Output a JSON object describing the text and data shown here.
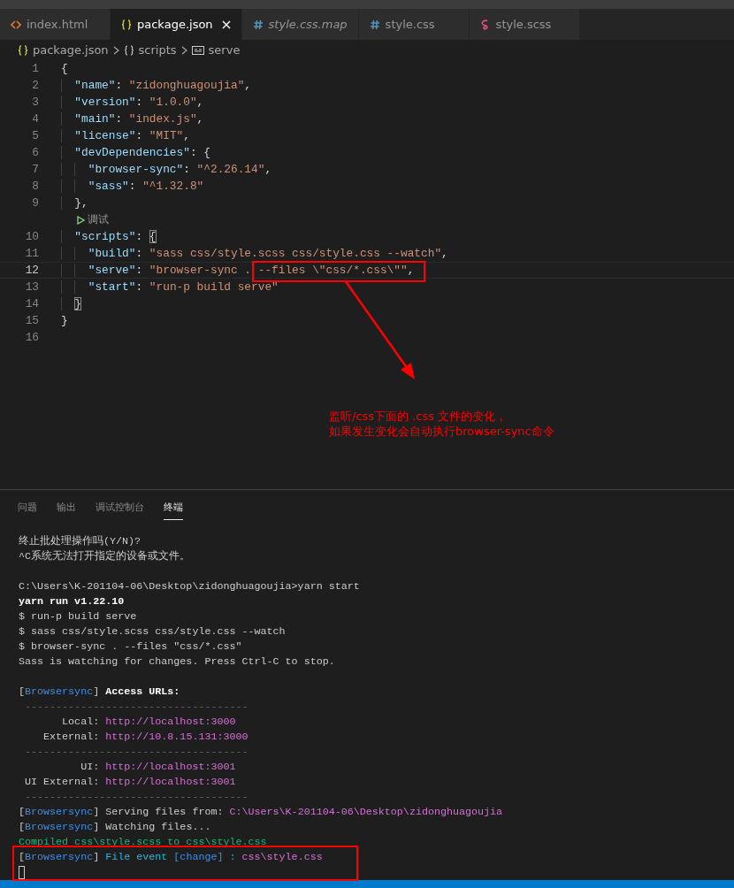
{
  "tabs": [
    {
      "label": "index.html",
      "kind": "html",
      "selected": false,
      "preview": false
    },
    {
      "label": "package.json",
      "kind": "json",
      "selected": true,
      "preview": false
    },
    {
      "label": "style.css.map",
      "kind": "css",
      "selected": false,
      "preview": true
    },
    {
      "label": "style.css",
      "kind": "css",
      "selected": false,
      "preview": false
    },
    {
      "label": "style.scss",
      "kind": "sass",
      "selected": false,
      "preview": false
    }
  ],
  "breadcrumb": [
    {
      "label": "package.json",
      "kind": "json"
    },
    {
      "label": "scripts",
      "kind": "object"
    },
    {
      "label": "serve",
      "kind": "string"
    }
  ],
  "editor": {
    "lines": [
      {
        "kind": "code",
        "number": "1",
        "current": false,
        "segments": [
          {
            "kind": "punct",
            "text": "{"
          }
        ]
      },
      {
        "kind": "code",
        "number": "2",
        "current": false,
        "segments": [
          {
            "kind": "key",
            "text": "  \"name\""
          },
          {
            "kind": "punct",
            "text": ": "
          },
          {
            "kind": "string",
            "text": "\"zidonghuagoujia\""
          },
          {
            "kind": "punct",
            "text": ","
          }
        ]
      },
      {
        "kind": "code",
        "number": "3",
        "current": false,
        "segments": [
          {
            "kind": "key",
            "text": "  \"version\""
          },
          {
            "kind": "punct",
            "text": ": "
          },
          {
            "kind": "string",
            "text": "\"1.0.0\""
          },
          {
            "kind": "punct",
            "text": ","
          }
        ]
      },
      {
        "kind": "code",
        "number": "4",
        "current": false,
        "segments": [
          {
            "kind": "key",
            "text": "  \"main\""
          },
          {
            "kind": "punct",
            "text": ": "
          },
          {
            "kind": "string",
            "text": "\"index.js\""
          },
          {
            "kind": "punct",
            "text": ","
          }
        ]
      },
      {
        "kind": "code",
        "number": "5",
        "current": false,
        "segments": [
          {
            "kind": "key",
            "text": "  \"license\""
          },
          {
            "kind": "punct",
            "text": ": "
          },
          {
            "kind": "string",
            "text": "\"MIT\""
          },
          {
            "kind": "punct",
            "text": ","
          }
        ]
      },
      {
        "kind": "code",
        "number": "6",
        "current": false,
        "segments": [
          {
            "kind": "key",
            "text": "  \"devDependencies\""
          },
          {
            "kind": "punct",
            "text": ": {"
          }
        ]
      },
      {
        "kind": "code",
        "number": "7",
        "current": false,
        "segments": [
          {
            "kind": "key",
            "text": "    \"browser-sync\""
          },
          {
            "kind": "punct",
            "text": ": "
          },
          {
            "kind": "string",
            "text": "\"^2.26.14\""
          },
          {
            "kind": "punct",
            "text": ","
          }
        ]
      },
      {
        "kind": "code",
        "number": "8",
        "current": false,
        "segments": [
          {
            "kind": "key",
            "text": "    \"sass\""
          },
          {
            "kind": "punct",
            "text": ": "
          },
          {
            "kind": "string",
            "text": "\"^1.32.8\""
          }
        ]
      },
      {
        "kind": "code",
        "number": "9",
        "current": false,
        "segments": [
          {
            "kind": "punct",
            "text": "  },"
          }
        ]
      },
      {
        "kind": "codelens",
        "text": "调试"
      },
      {
        "kind": "code",
        "number": "10",
        "current": false,
        "segments": [
          {
            "kind": "key",
            "text": "  \"scripts\""
          },
          {
            "kind": "punct",
            "text": ": "
          },
          {
            "kind": "bracket",
            "text": "{"
          }
        ]
      },
      {
        "kind": "code",
        "number": "11",
        "current": false,
        "segments": [
          {
            "kind": "key",
            "text": "    \"build\""
          },
          {
            "kind": "punct",
            "text": ": "
          },
          {
            "kind": "string",
            "text": "\"sass css/style.scss css/style.css --watch\""
          },
          {
            "kind": "punct",
            "text": ","
          }
        ]
      },
      {
        "kind": "code",
        "number": "12",
        "current": true,
        "segments": [
          {
            "kind": "key",
            "text": "    \"serve\""
          },
          {
            "kind": "punct",
            "text": ": "
          },
          {
            "kind": "string",
            "text": "\"browser-sync . --files \\\"css/*.css\\\"\""
          },
          {
            "kind": "punct",
            "text": ","
          }
        ]
      },
      {
        "kind": "code",
        "number": "13",
        "current": false,
        "segments": [
          {
            "kind": "key",
            "text": "    \"start\""
          },
          {
            "kind": "punct",
            "text": ": "
          },
          {
            "kind": "string",
            "text": "\"run-p build serve\""
          }
        ]
      },
      {
        "kind": "code",
        "number": "14",
        "current": false,
        "segments": [
          {
            "kind": "bracket",
            "text": "  }"
          }
        ]
      },
      {
        "kind": "code",
        "number": "15",
        "current": false,
        "segments": [
          {
            "kind": "punct",
            "text": "}"
          }
        ]
      },
      {
        "kind": "code",
        "number": "16",
        "current": false
      }
    ]
  },
  "annotation": {
    "lines": [
      "监听/css下面的 .css 文件的变化，",
      "如果发生变化会自动执行browser-sync命令"
    ]
  },
  "panel": {
    "tabs": [
      {
        "label": "问题",
        "selected": false
      },
      {
        "label": "输出",
        "selected": false
      },
      {
        "label": "调试控制台",
        "selected": false
      },
      {
        "label": "终端",
        "selected": true
      }
    ],
    "terminal": [
      {
        "kind": "text",
        "segments": [
          {
            "kind": "plain",
            "text": "终止批处理操作吗(Y/N)?"
          }
        ]
      },
      {
        "kind": "text",
        "segments": [
          {
            "kind": "plain",
            "text": "^C系统无法打开指定的设备或文件。"
          }
        ]
      },
      {
        "kind": "blank"
      },
      {
        "kind": "text",
        "segments": [
          {
            "kind": "plain",
            "text": "C:\\Users\\K-201104-06\\Desktop\\zidonghuagoujia>yarn start"
          }
        ]
      },
      {
        "kind": "text",
        "segments": [
          {
            "kind": "bold",
            "text": "yarn run v1.22.10"
          }
        ]
      },
      {
        "kind": "text",
        "segments": [
          {
            "kind": "plain",
            "text": "$ run-p build serve"
          }
        ]
      },
      {
        "kind": "text",
        "segments": [
          {
            "kind": "plain",
            "text": "$ sass css/style.scss css/style.css --watch"
          }
        ]
      },
      {
        "kind": "text",
        "segments": [
          {
            "kind": "plain",
            "text": "$ browser-sync . --files \"css/*.css\""
          }
        ]
      },
      {
        "kind": "text",
        "segments": [
          {
            "kind": "plain",
            "text": "Sass is watching for changes. Press Ctrl-C to stop."
          }
        ]
      },
      {
        "kind": "blank"
      },
      {
        "kind": "text",
        "segments": [
          {
            "kind": "plain",
            "text": "["
          },
          {
            "kind": "blue",
            "text": "Browsersync"
          },
          {
            "kind": "plain",
            "text": "] "
          },
          {
            "kind": "bold",
            "text": "Access URLs:"
          }
        ]
      },
      {
        "kind": "text",
        "segments": [
          {
            "kind": "dim",
            "text": " ------------------------------------"
          }
        ]
      },
      {
        "kind": "text",
        "segments": [
          {
            "kind": "plain",
            "text": "       Local: "
          },
          {
            "kind": "url",
            "text": "http://localhost:3000"
          }
        ]
      },
      {
        "kind": "text",
        "segments": [
          {
            "kind": "plain",
            "text": "    External: "
          },
          {
            "kind": "url",
            "text": "http://10.8.15.131:3000"
          }
        ]
      },
      {
        "kind": "text",
        "segments": [
          {
            "kind": "dim",
            "text": " ------------------------------------"
          }
        ]
      },
      {
        "kind": "text",
        "segments": [
          {
            "kind": "plain",
            "text": "          UI: "
          },
          {
            "kind": "url",
            "text": "http://localhost:3001"
          }
        ]
      },
      {
        "kind": "text",
        "segments": [
          {
            "kind": "plain",
            "text": " UI External: "
          },
          {
            "kind": "url",
            "text": "http://localhost:3001"
          }
        ]
      },
      {
        "kind": "text",
        "segments": [
          {
            "kind": "dim",
            "text": " ------------------------------------"
          }
        ]
      },
      {
        "kind": "text",
        "segments": [
          {
            "kind": "plain",
            "text": "["
          },
          {
            "kind": "blue",
            "text": "Browsersync"
          },
          {
            "kind": "plain",
            "text": "] Serving files from: "
          },
          {
            "kind": "url",
            "text": "C:\\Users\\K-201104-06\\Desktop\\zidonghuagoujia"
          }
        ]
      },
      {
        "kind": "text",
        "segments": [
          {
            "kind": "plain",
            "text": "["
          },
          {
            "kind": "blue",
            "text": "Browsersync"
          },
          {
            "kind": "plain",
            "text": "] Watching files..."
          }
        ]
      },
      {
        "kind": "text",
        "segments": [
          {
            "kind": "green",
            "text": "Compiled css\\style.scss to css\\style.css"
          }
        ]
      },
      {
        "kind": "text",
        "segments": [
          {
            "kind": "plain",
            "text": "["
          },
          {
            "kind": "blue",
            "text": "Browsersync"
          },
          {
            "kind": "plain",
            "text": "] "
          },
          {
            "kind": "cyan",
            "text": "File event "
          },
          {
            "kind": "blue",
            "text": "[change]"
          },
          {
            "kind": "cyan",
            "text": " : "
          },
          {
            "kind": "url",
            "text": "css\\style.css"
          }
        ]
      },
      {
        "kind": "cursor"
      }
    ]
  }
}
